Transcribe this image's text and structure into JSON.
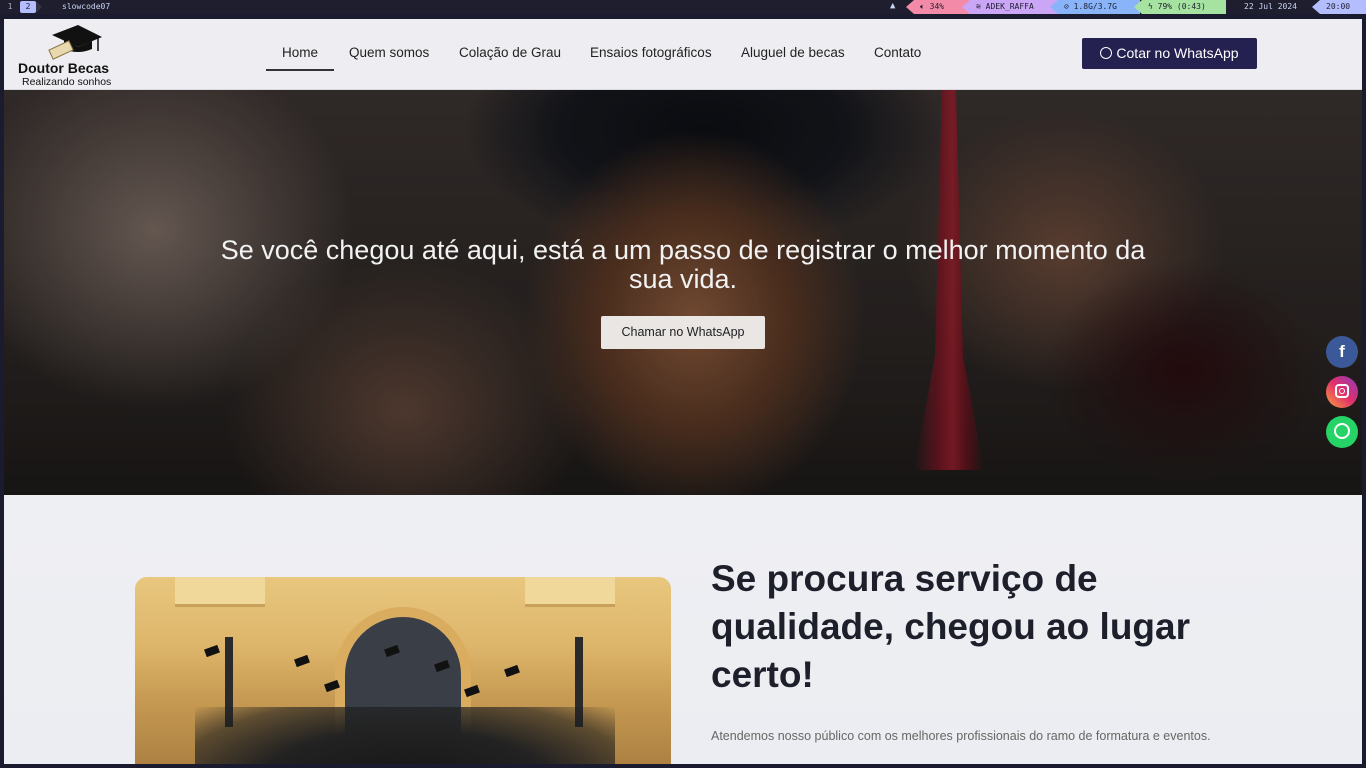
{
  "system_bar": {
    "workspaces": [
      "1",
      "2"
    ],
    "window_title": "slowcode07",
    "volume": "34%",
    "wifi": "ADEK_RAFFA",
    "memory": "1.8G/3.7G",
    "battery": "79% (0:43)",
    "date": "22 Jul 2024",
    "time": "20:00"
  },
  "header": {
    "logo_name": "Doutor Becas",
    "logo_tagline": "Realizando sonhos",
    "nav": [
      "Home",
      "Quem somos",
      "Colação de Grau",
      "Ensaios fotográficos",
      "Aluguel de becas",
      "Contato"
    ],
    "active_nav": "Home",
    "cta_label": "Cotar no WhatsApp"
  },
  "hero": {
    "title": "Se você chegou até aqui, está a um passo de registrar o melhor momento da sua vida.",
    "button_label": "Chamar no WhatsApp"
  },
  "social": {
    "facebook": "f"
  },
  "section": {
    "title": "Se procura serviço de qualidade, chegou ao lugar certo!",
    "text": "Atendemos nosso público com os melhores profissionais do ramo de formatura e eventos."
  },
  "colors": {
    "cta_bg": "#24204f",
    "facebook": "#3b5998",
    "whatsapp": "#25d366",
    "heading": "#1d1f2b"
  }
}
